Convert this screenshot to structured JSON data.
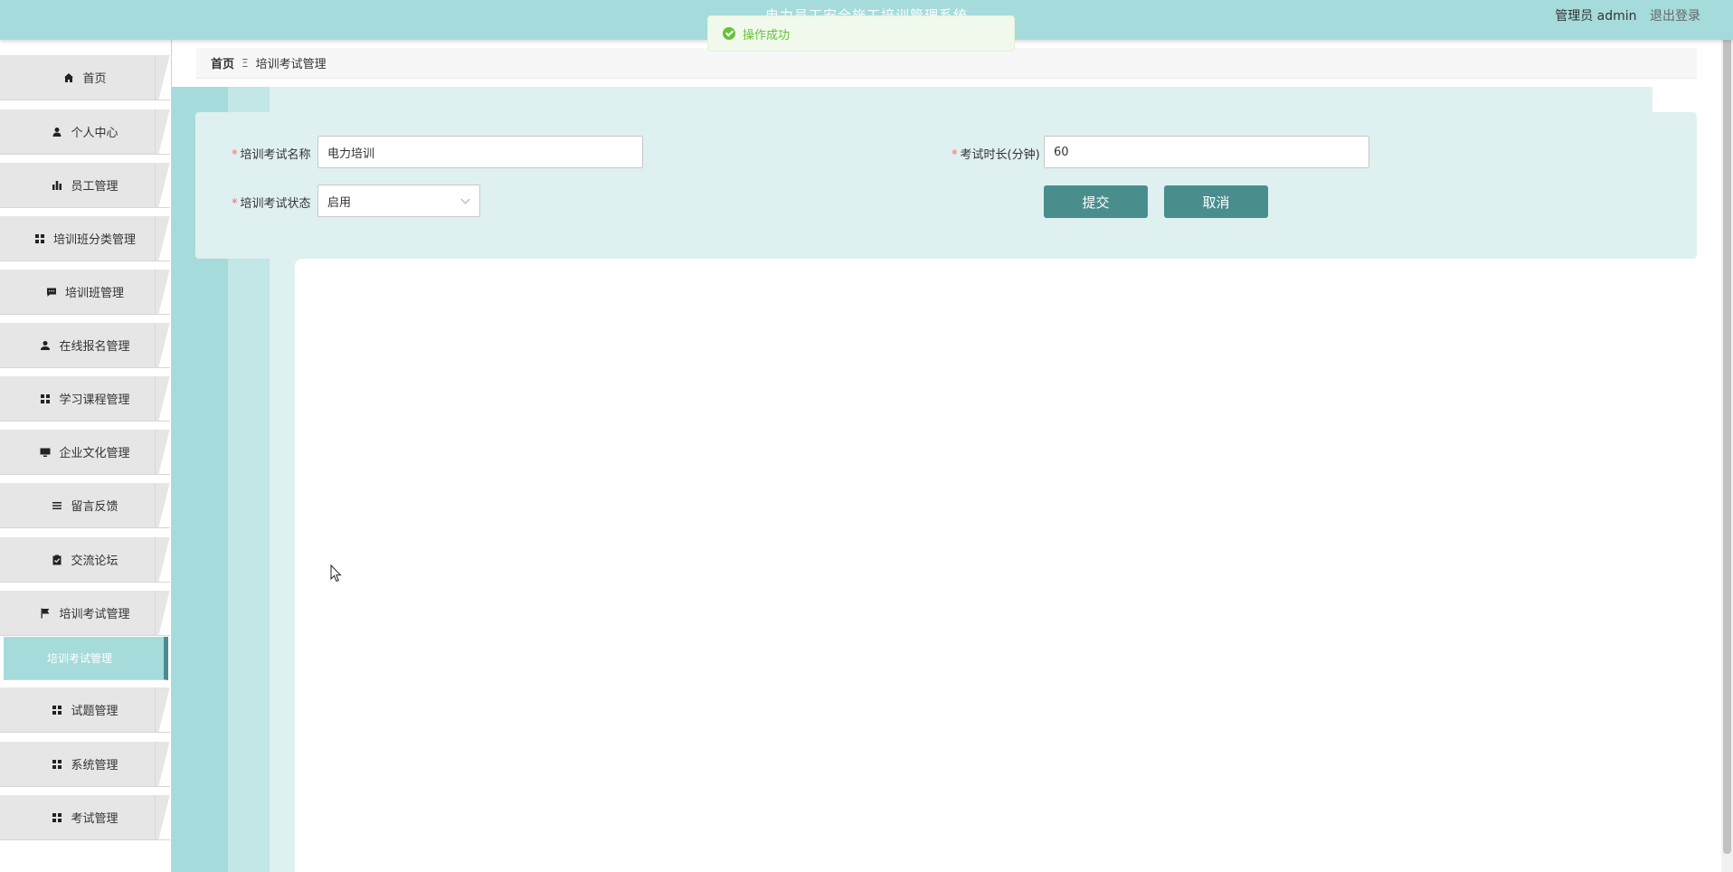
{
  "header": {
    "title": "电力员工安全施工培训管理系统",
    "user_label": "管理员 admin",
    "logout_label": "退出登录"
  },
  "toast": {
    "message": "操作成功",
    "icon": "check-circle-icon",
    "color": "#67c23a"
  },
  "sidebar": {
    "items": [
      {
        "label": "首页",
        "icon": "home-icon"
      },
      {
        "label": "个人中心",
        "icon": "user-icon"
      },
      {
        "label": "员工管理",
        "icon": "bar-chart-icon"
      },
      {
        "label": "培训班分类管理",
        "icon": "grid-icon"
      },
      {
        "label": "培训班管理",
        "icon": "chat-icon"
      },
      {
        "label": "在线报名管理",
        "icon": "person-icon"
      },
      {
        "label": "学习课程管理",
        "icon": "grid-icon"
      },
      {
        "label": "企业文化管理",
        "icon": "monitor-icon"
      },
      {
        "label": "留言反馈",
        "icon": "list-icon"
      },
      {
        "label": "交流论坛",
        "icon": "clipboard-check-icon"
      },
      {
        "label": "培训考试管理",
        "icon": "flag-icon"
      },
      {
        "label": "试题管理",
        "icon": "grid-icon"
      },
      {
        "label": "系统管理",
        "icon": "grid-icon"
      },
      {
        "label": "考试管理",
        "icon": "grid-icon"
      }
    ],
    "active_sub_item": "培训考试管理"
  },
  "breadcrumb": {
    "home": "首页",
    "separator": "Ξ",
    "current": "培训考试管理"
  },
  "form": {
    "exam_name_label": "培训考试名称",
    "exam_name_value": "电力培训",
    "duration_label": "考试时长(分钟)",
    "duration_value": "60",
    "status_label": "培训考试状态",
    "status_value": "启用",
    "submit_label": "提交",
    "cancel_label": "取消",
    "required_mark": "*"
  },
  "colors": {
    "header_bg": "#a6dbdb",
    "accent": "#4a8d8d",
    "panel_bg": "#dff0f0"
  }
}
